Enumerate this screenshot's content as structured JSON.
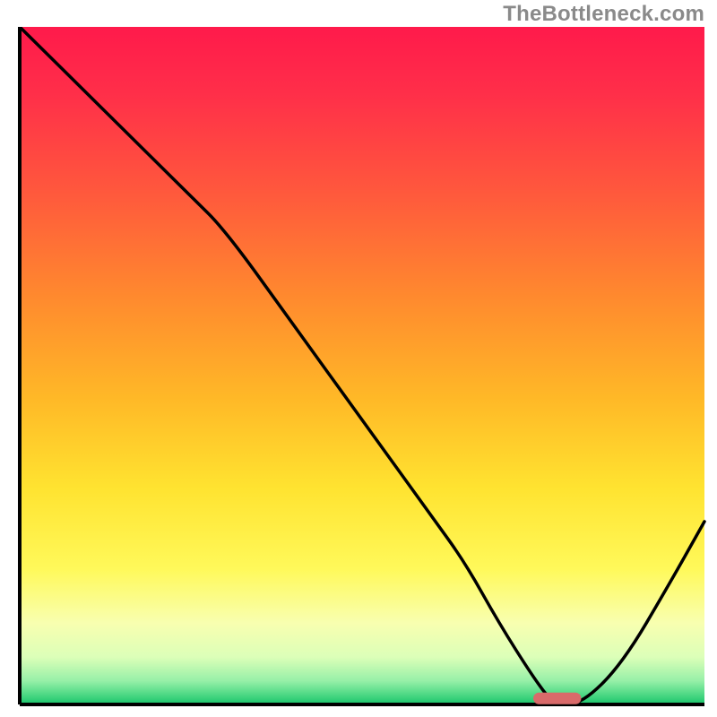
{
  "watermark": "TheBottleneck.com",
  "chart_data": {
    "type": "line",
    "title": "",
    "xlabel": "",
    "ylabel": "",
    "xlim": [
      0,
      100
    ],
    "ylim": [
      0,
      100
    ],
    "x": [
      0,
      10,
      20,
      25,
      30,
      40,
      50,
      60,
      65,
      70,
      75,
      78,
      82,
      88,
      95,
      100
    ],
    "y": [
      100,
      90,
      80,
      75,
      70,
      56,
      42,
      28,
      21,
      12,
      4,
      0,
      0,
      6,
      18,
      27
    ],
    "series_name": "bottleneck-curve",
    "marker": {
      "x_range": [
        75,
        82
      ],
      "y": 0.5,
      "color": "#d96a6a"
    },
    "gradient_stops": [
      {
        "pct": 0.0,
        "color": "#ff1a4b"
      },
      {
        "pct": 0.1,
        "color": "#ff2f49"
      },
      {
        "pct": 0.25,
        "color": "#ff5a3c"
      },
      {
        "pct": 0.4,
        "color": "#ff8a2e"
      },
      {
        "pct": 0.55,
        "color": "#ffb927"
      },
      {
        "pct": 0.68,
        "color": "#ffe330"
      },
      {
        "pct": 0.8,
        "color": "#fff95a"
      },
      {
        "pct": 0.88,
        "color": "#f8ffb0"
      },
      {
        "pct": 0.93,
        "color": "#dcffb8"
      },
      {
        "pct": 0.965,
        "color": "#97f0a8"
      },
      {
        "pct": 0.985,
        "color": "#4fd985"
      },
      {
        "pct": 1.0,
        "color": "#19c36b"
      }
    ]
  }
}
